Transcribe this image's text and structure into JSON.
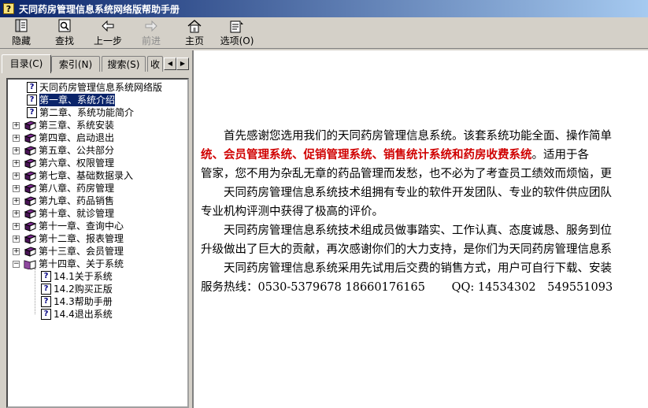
{
  "window": {
    "title": "天同药房管理信息系统网络版帮助手册",
    "app_icon_glyph": "?"
  },
  "toolbar": {
    "buttons": [
      {
        "label": "隐藏",
        "icon": "hide-icon"
      },
      {
        "label": "查找",
        "icon": "find-icon"
      },
      {
        "label": "上一步",
        "icon": "back-arrow-icon"
      },
      {
        "label": "前进",
        "icon": "forward-arrow-icon",
        "disabled": true
      },
      {
        "label": "主页",
        "icon": "home-icon"
      },
      {
        "label": "选项(O)",
        "icon": "options-icon"
      }
    ]
  },
  "tabs": [
    {
      "label": "目录(C)",
      "active": true
    },
    {
      "label": "索引(N)"
    },
    {
      "label": "搜索(S)"
    },
    {
      "label": "收"
    }
  ],
  "tree": {
    "items": [
      {
        "label": "天同药房管理信息系统网络版",
        "type": "page"
      },
      {
        "label": "第一章、系统介绍",
        "type": "page",
        "selected": true
      },
      {
        "label": "第二章、系统功能简介",
        "type": "page"
      },
      {
        "label": "第三章、系统安装",
        "type": "book"
      },
      {
        "label": "第四章、启动退出",
        "type": "book"
      },
      {
        "label": "第五章、公共部分",
        "type": "book"
      },
      {
        "label": "第六章、权限管理",
        "type": "book"
      },
      {
        "label": "第七章、基础数据录入",
        "type": "book"
      },
      {
        "label": "第八章、药房管理",
        "type": "book"
      },
      {
        "label": "第九章、药品销售",
        "type": "book"
      },
      {
        "label": "第十章、就诊管理",
        "type": "book"
      },
      {
        "label": "第十一章、查询中心",
        "type": "book"
      },
      {
        "label": "第十二章、报表管理",
        "type": "book"
      },
      {
        "label": "第十三章、会员管理",
        "type": "book"
      },
      {
        "label": "第十四章、关于系统",
        "type": "book-open"
      },
      {
        "label": "14.1关于系统",
        "type": "page",
        "child": true
      },
      {
        "label": "14.2购买正版",
        "type": "page",
        "child": true
      },
      {
        "label": "14.3帮助手册",
        "type": "page",
        "child": true
      },
      {
        "label": "14.4退出系统",
        "type": "page",
        "child": true
      }
    ],
    "expander_plus": "+",
    "expander_minus": "−"
  },
  "content": {
    "p1": "　　首先感谢您选用我们的天同药房管理信息系统。该套系统功能全面、操作简单",
    "p2_red": "统、会员管理系统、促销管理系统、销售统计系统和药房收费系统",
    "p2_rest": "。适用于各",
    "p3": "管家，您不用为杂乱无章的药品管理而发愁，也不必为了考查员工绩效而烦恼，更",
    "p4": "　　天同药房管理信息系统技术组拥有专业的软件开发团队、专业的软件供应团队",
    "p5": "专业机构评测中获得了极高的评价。",
    "p6": "　　天同药房管理信息系统技术组成员做事踏实、工作认真、态度诚恳、服务到位",
    "p7": "升级做出了巨大的贡献，再次感谢你们的大力支持，是你们为天同药房管理信息系",
    "p8": "　　天同药房管理信息系统采用先试用后交费的销售方式，用户可自行下载、安装",
    "p9": "服务热线：0530-5379678 18660176165　　 QQ: 14534302　549551093"
  },
  "colors": {
    "titlebar_start": "#0a246a",
    "titlebar_end": "#a6caf0",
    "highlight": "#d00000",
    "book_purple": "#7b2a8e"
  }
}
